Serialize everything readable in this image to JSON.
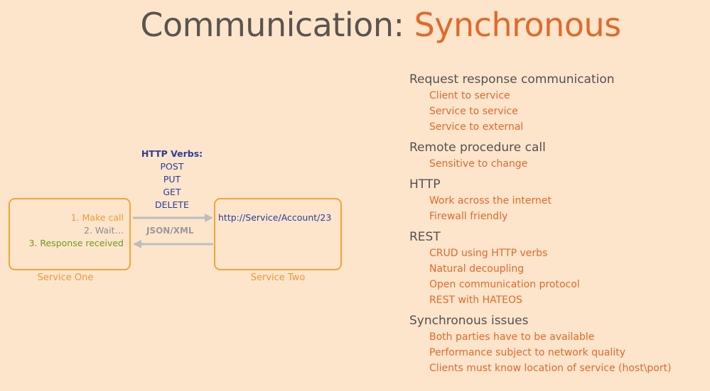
{
  "title": {
    "part1": "Communication: ",
    "part2": "Synchronous"
  },
  "diagram": {
    "verbs_header": "HTTP Verbs:",
    "verbs": [
      "POST",
      "PUT",
      "GET",
      "DELETE"
    ],
    "service_one": {
      "label": "Service One",
      "steps": [
        "1. Make call",
        "2. Wait…",
        "3. Response received"
      ]
    },
    "service_two": {
      "label": "Service Two",
      "url": "http://Service/Account/23"
    },
    "payload": "JSON/XML"
  },
  "topics": [
    {
      "title": "Request response communication",
      "items": [
        "Client to service",
        "Service to service",
        "Service to external"
      ]
    },
    {
      "title": "Remote procedure call",
      "items": [
        "Sensitive to change"
      ]
    },
    {
      "title": "HTTP",
      "items": [
        "Work across the internet",
        "Firewall friendly"
      ]
    },
    {
      "title": "REST",
      "items": [
        "CRUD using HTTP verbs",
        "Natural decoupling",
        "Open communication protocol",
        "REST with HATEOS"
      ]
    },
    {
      "title": "Synchronous issues",
      "items": [
        "Both parties have to be available",
        "Performance subject to network quality",
        "Clients must know location of service (host\\port)"
      ]
    }
  ],
  "colors": {
    "background": "#fde5cc",
    "accent": "#e06a2a",
    "box_border": "#f2a437",
    "verbs": "#2c3c9a",
    "arrow": "#bdbdbd"
  }
}
